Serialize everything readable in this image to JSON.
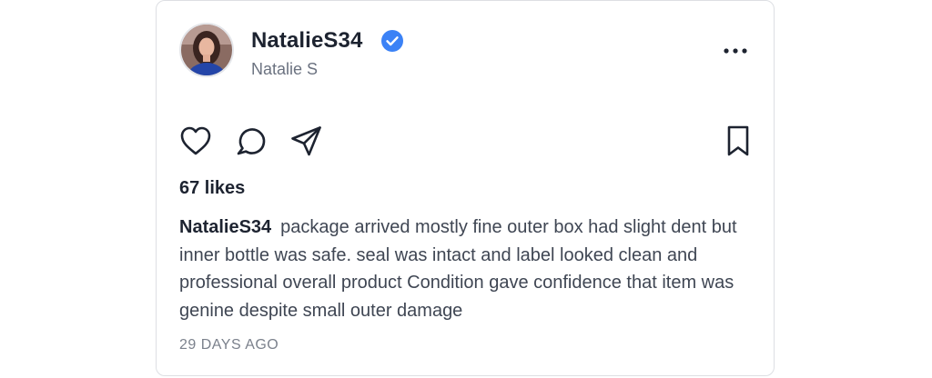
{
  "post": {
    "username": "NatalieS34",
    "display_name": "Natalie S",
    "verified": true,
    "likes_text": "67 likes",
    "caption_user": "NatalieS34",
    "caption_text": "package arrived mostly fine outer box had slight dent but inner bottle was safe. seal was intact and label looked clean and professional overall product Condition gave confidence that item was genine despite small outer damage",
    "timestamp": "29 DAYS AGO"
  },
  "icons": {
    "verified": "verified-badge-icon",
    "more": "more-options-icon",
    "like": "heart-icon",
    "comment": "comment-icon",
    "share": "send-icon",
    "bookmark": "bookmark-icon"
  },
  "colors": {
    "verified_badge": "#3b82f6",
    "text_primary": "#1d2330",
    "text_secondary": "#6b7280",
    "card_border": "#dddfe3"
  }
}
